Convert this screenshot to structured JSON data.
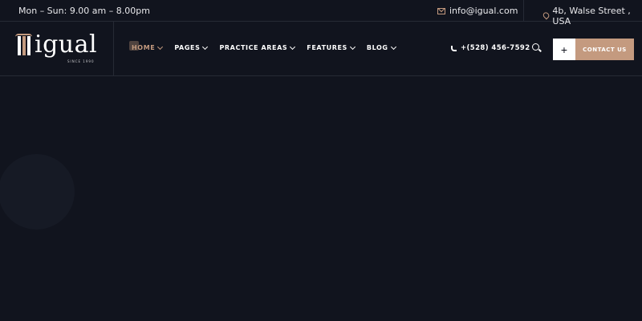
{
  "topbar": {
    "hours": "Mon – Sun: 9.00 am – 8.00pm",
    "email": "info@igual.com",
    "address": "4b, Walse Street , USA",
    "email_icon": "mail-icon",
    "address_icon": "map-pin-icon"
  },
  "header": {
    "logo_text": "igual",
    "logo_sub": "SINCE 1990",
    "nav": [
      {
        "label": "HOME",
        "active": true
      },
      {
        "label": "PAGES"
      },
      {
        "label": "PRACTICE AREAS"
      },
      {
        "label": "FEATURES"
      },
      {
        "label": "BLOG"
      }
    ],
    "phone": "+(528) 456-7592",
    "plus_label": "+",
    "contact_label": "CONTACT US"
  },
  "colors": {
    "background": "#11141e",
    "accent": "#c49a7f",
    "text": "#ffffff"
  }
}
